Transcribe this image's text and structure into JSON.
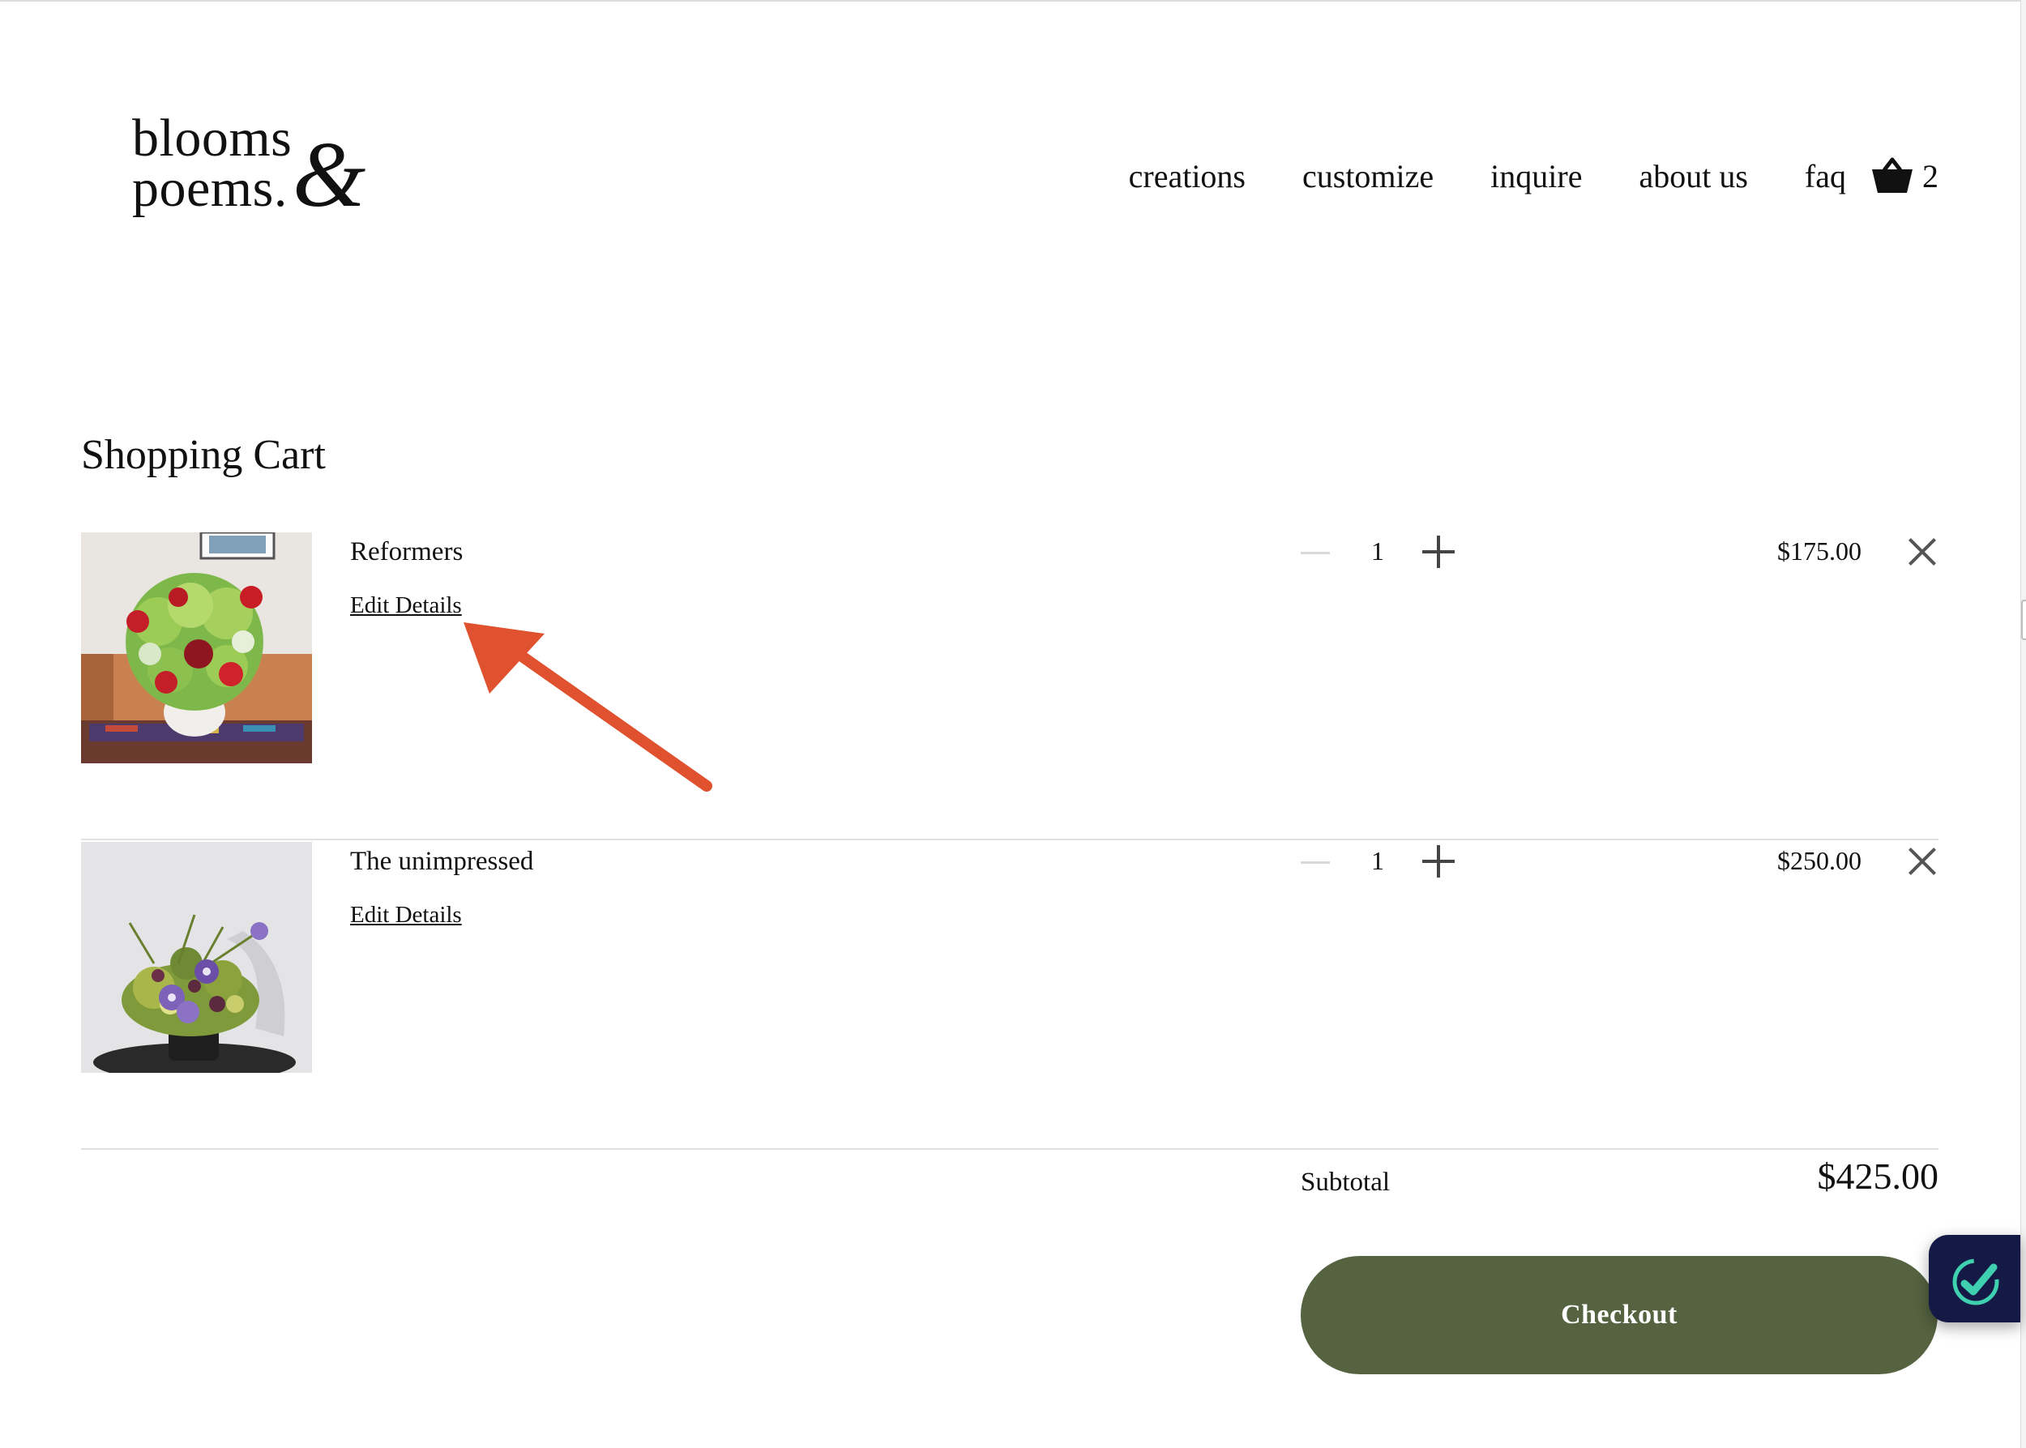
{
  "header": {
    "logo": {
      "line1": "blooms",
      "line2": "poems.",
      "ampersand": "&"
    },
    "nav": {
      "items": [
        {
          "label": "creations"
        },
        {
          "label": "customize"
        },
        {
          "label": "inquire"
        },
        {
          "label": "about us"
        },
        {
          "label": "faq"
        }
      ],
      "cart_icon": "basket-icon",
      "cart_count": "2"
    }
  },
  "page": {
    "title": "Shopping Cart"
  },
  "cart": {
    "items": [
      {
        "name": "Reformers",
        "edit_label": "Edit Details",
        "quantity": "1",
        "price": "$175.00",
        "thumbnail_icon": "flower-arrangement-red-green"
      },
      {
        "name": "The unimpressed",
        "edit_label": "Edit Details",
        "quantity": "1",
        "price": "$250.00",
        "thumbnail_icon": "flower-arrangement-purple"
      }
    ],
    "subtotal_label": "Subtotal",
    "subtotal_value": "$425.00",
    "checkout_label": "Checkout"
  },
  "colors": {
    "checkout_button": "#556341",
    "annotation_arrow": "#e0522f",
    "widget_bg": "#141a45",
    "widget_accent": "#3fd0b0"
  },
  "icons": {
    "quantity_decrease": "minus-icon",
    "quantity_increase": "plus-icon",
    "remove": "close-icon",
    "widget": "check-badge-icon",
    "annotation": "arrow-annotation"
  }
}
